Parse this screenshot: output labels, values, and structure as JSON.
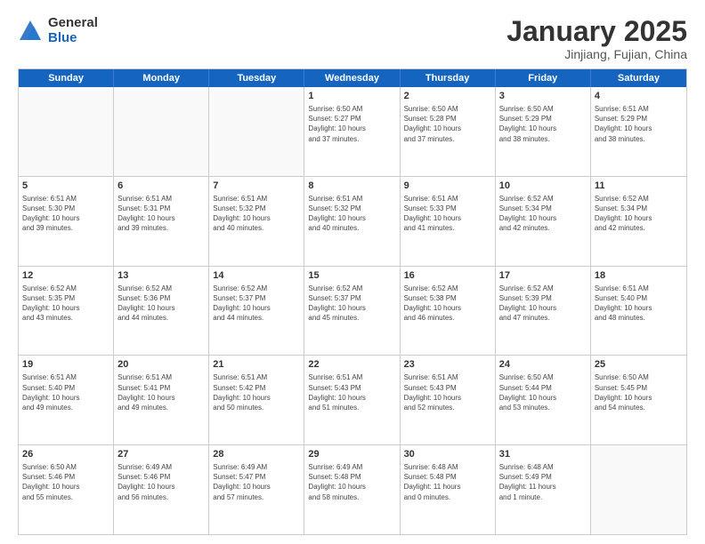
{
  "logo": {
    "general": "General",
    "blue": "Blue"
  },
  "header": {
    "month": "January 2025",
    "location": "Jinjiang, Fujian, China"
  },
  "weekdays": [
    "Sunday",
    "Monday",
    "Tuesday",
    "Wednesday",
    "Thursday",
    "Friday",
    "Saturday"
  ],
  "weeks": [
    [
      {
        "day": "",
        "info": ""
      },
      {
        "day": "",
        "info": ""
      },
      {
        "day": "",
        "info": ""
      },
      {
        "day": "1",
        "info": "Sunrise: 6:50 AM\nSunset: 5:27 PM\nDaylight: 10 hours\nand 37 minutes."
      },
      {
        "day": "2",
        "info": "Sunrise: 6:50 AM\nSunset: 5:28 PM\nDaylight: 10 hours\nand 37 minutes."
      },
      {
        "day": "3",
        "info": "Sunrise: 6:50 AM\nSunset: 5:29 PM\nDaylight: 10 hours\nand 38 minutes."
      },
      {
        "day": "4",
        "info": "Sunrise: 6:51 AM\nSunset: 5:29 PM\nDaylight: 10 hours\nand 38 minutes."
      }
    ],
    [
      {
        "day": "5",
        "info": "Sunrise: 6:51 AM\nSunset: 5:30 PM\nDaylight: 10 hours\nand 39 minutes."
      },
      {
        "day": "6",
        "info": "Sunrise: 6:51 AM\nSunset: 5:31 PM\nDaylight: 10 hours\nand 39 minutes."
      },
      {
        "day": "7",
        "info": "Sunrise: 6:51 AM\nSunset: 5:32 PM\nDaylight: 10 hours\nand 40 minutes."
      },
      {
        "day": "8",
        "info": "Sunrise: 6:51 AM\nSunset: 5:32 PM\nDaylight: 10 hours\nand 40 minutes."
      },
      {
        "day": "9",
        "info": "Sunrise: 6:51 AM\nSunset: 5:33 PM\nDaylight: 10 hours\nand 41 minutes."
      },
      {
        "day": "10",
        "info": "Sunrise: 6:52 AM\nSunset: 5:34 PM\nDaylight: 10 hours\nand 42 minutes."
      },
      {
        "day": "11",
        "info": "Sunrise: 6:52 AM\nSunset: 5:34 PM\nDaylight: 10 hours\nand 42 minutes."
      }
    ],
    [
      {
        "day": "12",
        "info": "Sunrise: 6:52 AM\nSunset: 5:35 PM\nDaylight: 10 hours\nand 43 minutes."
      },
      {
        "day": "13",
        "info": "Sunrise: 6:52 AM\nSunset: 5:36 PM\nDaylight: 10 hours\nand 44 minutes."
      },
      {
        "day": "14",
        "info": "Sunrise: 6:52 AM\nSunset: 5:37 PM\nDaylight: 10 hours\nand 44 minutes."
      },
      {
        "day": "15",
        "info": "Sunrise: 6:52 AM\nSunset: 5:37 PM\nDaylight: 10 hours\nand 45 minutes."
      },
      {
        "day": "16",
        "info": "Sunrise: 6:52 AM\nSunset: 5:38 PM\nDaylight: 10 hours\nand 46 minutes."
      },
      {
        "day": "17",
        "info": "Sunrise: 6:52 AM\nSunset: 5:39 PM\nDaylight: 10 hours\nand 47 minutes."
      },
      {
        "day": "18",
        "info": "Sunrise: 6:51 AM\nSunset: 5:40 PM\nDaylight: 10 hours\nand 48 minutes."
      }
    ],
    [
      {
        "day": "19",
        "info": "Sunrise: 6:51 AM\nSunset: 5:40 PM\nDaylight: 10 hours\nand 49 minutes."
      },
      {
        "day": "20",
        "info": "Sunrise: 6:51 AM\nSunset: 5:41 PM\nDaylight: 10 hours\nand 49 minutes."
      },
      {
        "day": "21",
        "info": "Sunrise: 6:51 AM\nSunset: 5:42 PM\nDaylight: 10 hours\nand 50 minutes."
      },
      {
        "day": "22",
        "info": "Sunrise: 6:51 AM\nSunset: 5:43 PM\nDaylight: 10 hours\nand 51 minutes."
      },
      {
        "day": "23",
        "info": "Sunrise: 6:51 AM\nSunset: 5:43 PM\nDaylight: 10 hours\nand 52 minutes."
      },
      {
        "day": "24",
        "info": "Sunrise: 6:50 AM\nSunset: 5:44 PM\nDaylight: 10 hours\nand 53 minutes."
      },
      {
        "day": "25",
        "info": "Sunrise: 6:50 AM\nSunset: 5:45 PM\nDaylight: 10 hours\nand 54 minutes."
      }
    ],
    [
      {
        "day": "26",
        "info": "Sunrise: 6:50 AM\nSunset: 5:46 PM\nDaylight: 10 hours\nand 55 minutes."
      },
      {
        "day": "27",
        "info": "Sunrise: 6:49 AM\nSunset: 5:46 PM\nDaylight: 10 hours\nand 56 minutes."
      },
      {
        "day": "28",
        "info": "Sunrise: 6:49 AM\nSunset: 5:47 PM\nDaylight: 10 hours\nand 57 minutes."
      },
      {
        "day": "29",
        "info": "Sunrise: 6:49 AM\nSunset: 5:48 PM\nDaylight: 10 hours\nand 58 minutes."
      },
      {
        "day": "30",
        "info": "Sunrise: 6:48 AM\nSunset: 5:48 PM\nDaylight: 11 hours\nand 0 minutes."
      },
      {
        "day": "31",
        "info": "Sunrise: 6:48 AM\nSunset: 5:49 PM\nDaylight: 11 hours\nand 1 minute."
      },
      {
        "day": "",
        "info": ""
      }
    ]
  ]
}
